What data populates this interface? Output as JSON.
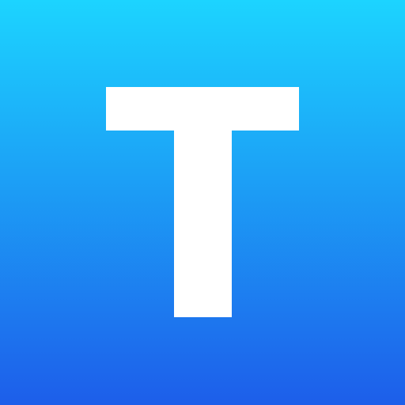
{
  "icon": {
    "letter": "T",
    "colors": {
      "gradient_top": "#1CD4FF",
      "gradient_bottom": "#1D5EEA",
      "glyph": "#FFFFFF"
    }
  }
}
